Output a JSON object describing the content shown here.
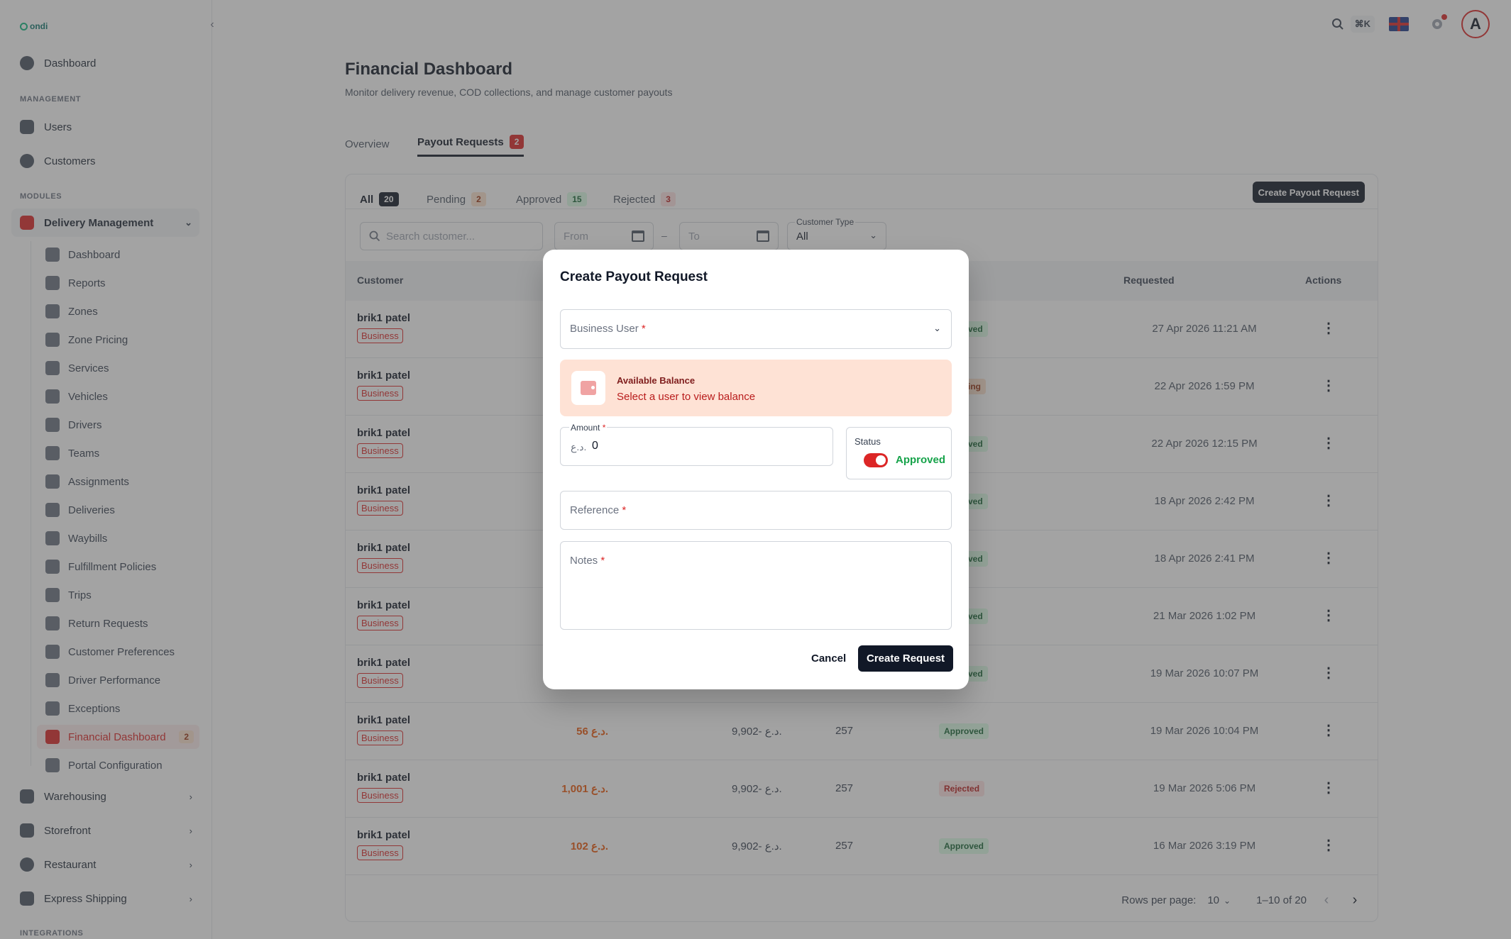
{
  "app": {
    "logo_text": "ondi"
  },
  "sidebar": {
    "dashboard": "Dashboard",
    "section_management": "MANAGEMENT",
    "users": "Users",
    "customers": "Customers",
    "section_modules": "MODULES",
    "delivery_management": "Delivery Management",
    "delivery_items": [
      {
        "label": "Dashboard",
        "icon": "gauge-icon"
      },
      {
        "label": "Reports",
        "icon": "chart-icon"
      },
      {
        "label": "Zones",
        "icon": "map-pin-icon"
      },
      {
        "label": "Zone Pricing",
        "icon": "price-icon"
      },
      {
        "label": "Services",
        "icon": "services-icon"
      },
      {
        "label": "Vehicles",
        "icon": "vehicle-icon"
      },
      {
        "label": "Drivers",
        "icon": "driver-icon"
      },
      {
        "label": "Teams",
        "icon": "team-icon"
      },
      {
        "label": "Assignments",
        "icon": "assignment-icon"
      },
      {
        "label": "Deliveries",
        "icon": "truck-icon"
      },
      {
        "label": "Waybills",
        "icon": "waybill-icon"
      },
      {
        "label": "Fulfillment Policies",
        "icon": "policy-icon"
      },
      {
        "label": "Trips",
        "icon": "trip-icon"
      },
      {
        "label": "Return Requests",
        "icon": "return-icon"
      },
      {
        "label": "Customer Preferences",
        "icon": "sliders-icon"
      },
      {
        "label": "Driver Performance",
        "icon": "performance-icon"
      },
      {
        "label": "Exceptions",
        "icon": "warning-icon"
      },
      {
        "label": "Financial Dashboard",
        "icon": "finance-icon",
        "badge": "2"
      },
      {
        "label": "Portal Configuration",
        "icon": "wrench-icon"
      }
    ],
    "warehousing": "Warehousing",
    "storefront": "Storefront",
    "restaurant": "Restaurant",
    "express_shipping": "Express Shipping",
    "section_integrations": "INTEGRATIONS"
  },
  "topbar": {
    "shortcut": "⌘K",
    "avatar_letter": "A"
  },
  "page": {
    "title": "Financial Dashboard",
    "subtitle": "Monitor delivery revenue, COD collections, and manage customer payouts",
    "tabs": [
      {
        "label": "Overview"
      },
      {
        "label": "Payout Requests",
        "count": "2"
      }
    ]
  },
  "payouts": {
    "filter_tabs": [
      {
        "label": "All",
        "count": "20"
      },
      {
        "label": "Pending",
        "count": "2"
      },
      {
        "label": "Approved",
        "count": "15"
      },
      {
        "label": "Rejected",
        "count": "3"
      }
    ],
    "create_button": "Create Payout Request",
    "search_placeholder": "Search customer...",
    "from_placeholder": "From",
    "to_placeholder": "To",
    "date_separator": "–",
    "customer_type_label": "Customer Type",
    "customer_type_value": "All",
    "columns": {
      "customer": "Customer",
      "status": "us",
      "requested": "Requested",
      "actions": "Actions"
    },
    "rows": [
      {
        "name": "brik1 patel",
        "badge": "Business",
        "status": "ved",
        "status_type": "approved",
        "requested": "27 Apr 2026 11:21 AM"
      },
      {
        "name": "brik1 patel",
        "badge": "Business",
        "status": "ing",
        "status_type": "pending",
        "requested": "22 Apr 2026 1:59 PM"
      },
      {
        "name": "brik1 patel",
        "badge": "Business",
        "status": "ved",
        "status_type": "approved",
        "requested": "22 Apr 2026 12:15 PM"
      },
      {
        "name": "brik1 patel",
        "badge": "Business",
        "status": "ved",
        "status_type": "approved",
        "requested": "18 Apr 2026 2:42 PM"
      },
      {
        "name": "brik1 patel",
        "badge": "Business",
        "status": "ved",
        "status_type": "approved",
        "requested": "18 Apr 2026 2:41 PM"
      },
      {
        "name": "brik1 patel",
        "badge": "Business",
        "status": "ved",
        "status_type": "approved",
        "requested": "21 Mar 2026 1:02 PM"
      },
      {
        "name": "brik1 patel",
        "badge": "Business",
        "status": "ved",
        "status_type": "approved",
        "requested": "19 Mar 2026 10:07 PM"
      },
      {
        "name": "brik1 patel",
        "badge": "Business",
        "amount": "56 د.ع.",
        "balance": "9,902- د.ع.",
        "count": "257",
        "status": "Approved",
        "status_type": "approved",
        "requested": "19 Mar 2026 10:04 PM"
      },
      {
        "name": "brik1 patel",
        "badge": "Business",
        "amount": "1,001 د.ع.",
        "balance": "9,902- د.ع.",
        "count": "257",
        "status": "Rejected",
        "status_type": "rejected",
        "requested": "19 Mar 2026 5:06 PM"
      },
      {
        "name": "brik1 patel",
        "badge": "Business",
        "amount": "102 د.ع.",
        "balance": "9,902- د.ع.",
        "count": "257",
        "status": "Approved",
        "status_type": "approved",
        "requested": "16 Mar 2026 3:19 PM"
      }
    ],
    "pagination": {
      "rows_per_page_label": "Rows per page:",
      "rows_per_page": "10",
      "range": "1–10 of 20"
    }
  },
  "modal": {
    "title": "Create Payout Request",
    "business_user_placeholder": "Business User",
    "required_mark": "*",
    "balance_title": "Available Balance",
    "balance_text": "Select a user to view balance",
    "amount_label": "Amount",
    "amount_currency": "د.ع.",
    "amount_value": "0",
    "status_label": "Status",
    "status_value": "Approved",
    "status_on": true,
    "reference_placeholder": "Reference",
    "notes_placeholder": "Notes",
    "cancel": "Cancel",
    "submit": "Create Request"
  }
}
